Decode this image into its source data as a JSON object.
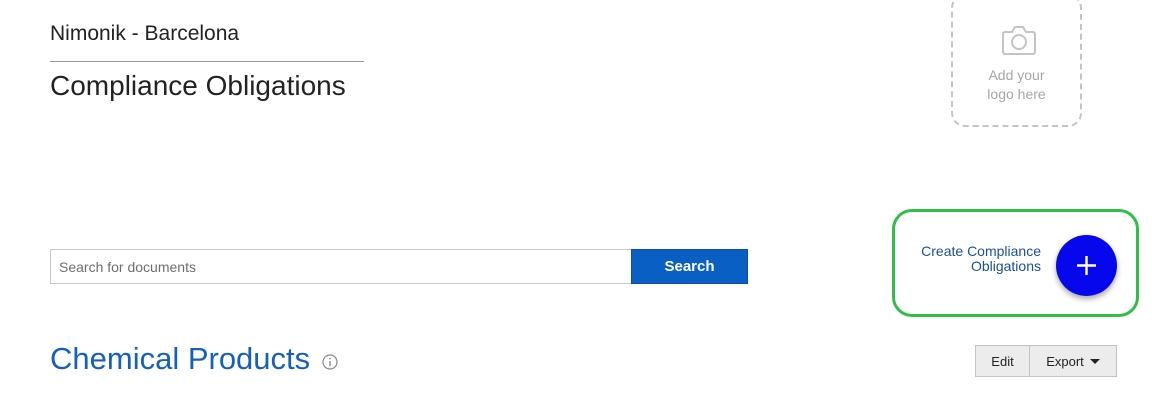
{
  "header": {
    "organization": "Nimonik - Barcelona",
    "page_title": "Compliance Obligations"
  },
  "logo_upload": {
    "icon": "camera-icon",
    "line1": "Add your",
    "line2": "logo here"
  },
  "search": {
    "placeholder": "Search for documents",
    "value": "",
    "button_label": "Search"
  },
  "create": {
    "label_line1": "Create Compliance",
    "label_line2": "Obligations",
    "icon": "plus-icon",
    "highlight_color": "#2ec046",
    "button_color": "#0707ee"
  },
  "section": {
    "title": "Chemical Products",
    "info_icon": "info-icon"
  },
  "actions": {
    "edit_label": "Edit",
    "export_label": "Export",
    "export_icon": "caret-down-icon"
  },
  "colors": {
    "accent": "#0a5fc4",
    "section_title": "#1460c0"
  }
}
